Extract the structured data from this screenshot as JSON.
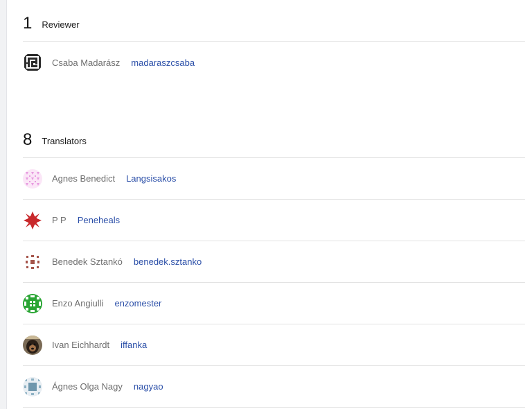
{
  "reviewers": {
    "count": "1",
    "label": "Reviewer",
    "members": [
      {
        "name": "Csaba Madarász",
        "username": "madaraszcsaba",
        "avatar": "avatar-maze"
      }
    ]
  },
  "translators": {
    "count": "8",
    "label": "Translators",
    "members": [
      {
        "name": "Agnes Benedict",
        "username": "Langsisakos",
        "avatar": "avatar-pink-pattern"
      },
      {
        "name": "P P",
        "username": "Peneheals",
        "avatar": "avatar-red-flower"
      },
      {
        "name": "Benedek Sztankó",
        "username": "benedek.sztanko",
        "avatar": "avatar-brown-dots"
      },
      {
        "name": "Enzo Angiulli",
        "username": "enzomester",
        "avatar": "avatar-green-pattern"
      },
      {
        "name": "Ivan Eichhardt",
        "username": "iffanka",
        "avatar": "avatar-dog-photo"
      },
      {
        "name": "Ágnes Olga Nagy",
        "username": "nagyao",
        "avatar": "avatar-blue-square"
      }
    ]
  },
  "colors": {
    "link": "#2b4fa8",
    "name_text": "#6f6f6f",
    "divider": "#e3e3e3"
  }
}
